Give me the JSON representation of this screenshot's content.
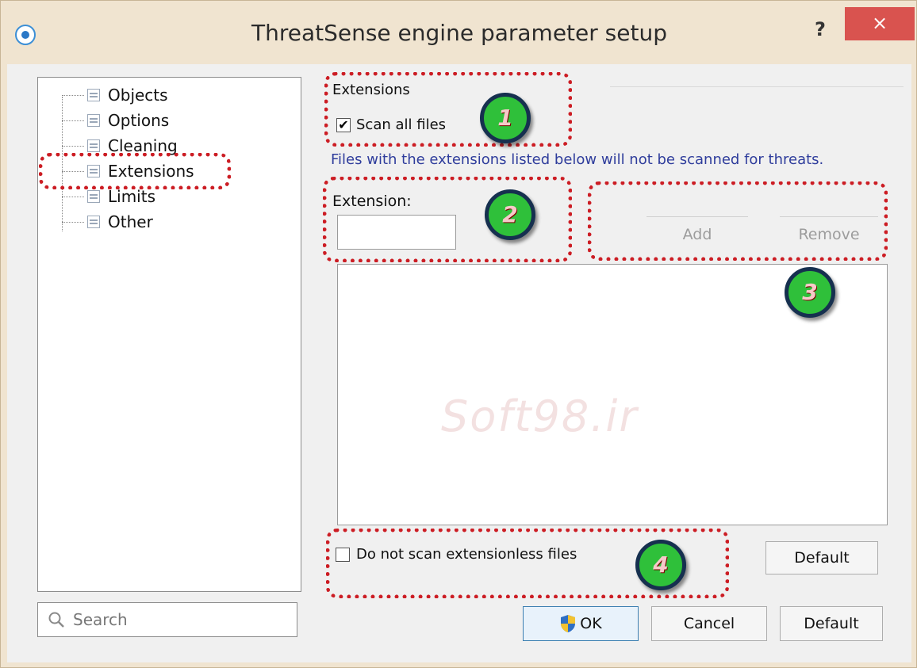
{
  "window": {
    "title": "ThreatSense engine parameter setup",
    "help_label": "?",
    "close_label": "×"
  },
  "tree": {
    "items": [
      {
        "label": "Objects"
      },
      {
        "label": "Options"
      },
      {
        "label": "Cleaning"
      },
      {
        "label": "Extensions"
      },
      {
        "label": "Limits"
      },
      {
        "label": "Other"
      }
    ],
    "selected": "Extensions"
  },
  "search": {
    "placeholder": "Search",
    "icon": "search-icon"
  },
  "extensions": {
    "section_title": "Extensions",
    "scan_all_label": "Scan all files",
    "scan_all_checked": true,
    "checkmark": "✔",
    "info_text": "Files with the extensions listed below will not be scanned for threats.",
    "extension_label": "Extension:",
    "extension_value": "",
    "add_label": "Add",
    "remove_label": "Remove",
    "list_items": [],
    "extensionless_label": "Do not scan extensionless files",
    "extensionless_checked": false,
    "default_label": "Default"
  },
  "footer": {
    "ok_label": "OK",
    "cancel_label": "Cancel",
    "default_label": "Default"
  },
  "watermark": "Soft98.ir",
  "badges": [
    "1",
    "2",
    "3",
    "4"
  ],
  "colors": {
    "callout": "#cc1d24",
    "badge": "#2fc03a",
    "info_text": "#2f3d9c",
    "close_button": "#d9534f"
  }
}
